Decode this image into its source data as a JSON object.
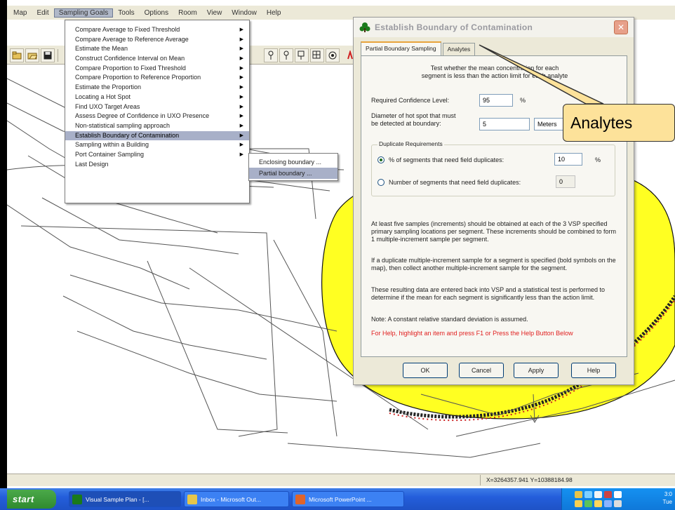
{
  "menubar": {
    "items": [
      "Map",
      "Edit",
      "Sampling Goals",
      "Tools",
      "Options",
      "Room",
      "View",
      "Window",
      "Help"
    ],
    "active_index": 2
  },
  "toolbar": {
    "icons": [
      "open-icon",
      "open-folder-icon",
      "save-icon",
      "print-icon",
      "pin-icon",
      "pin-question-icon",
      "pin-check-icon",
      "pin-grid-icon",
      "target-icon",
      "help-icon"
    ]
  },
  "sampling_menu": {
    "items": [
      {
        "label": "Compare Average to Fixed Threshold",
        "submenu": true
      },
      {
        "label": "Compare Average to Reference Average",
        "submenu": true
      },
      {
        "label": "Estimate the Mean",
        "submenu": true
      },
      {
        "label": "Construct Confidence Interval on Mean",
        "submenu": true
      },
      {
        "label": "Compare Proportion to Fixed Threshold",
        "submenu": true
      },
      {
        "label": "Compare Proportion to Reference Proportion",
        "submenu": true
      },
      {
        "label": "Estimate the Proportion",
        "submenu": true
      },
      {
        "label": "Locating a Hot Spot",
        "submenu": true
      },
      {
        "label": "Find UXO Target Areas",
        "submenu": true
      },
      {
        "label": "Assess Degree of Confidence in UXO Presence",
        "submenu": true
      },
      {
        "label": "Non-statistical sampling approach",
        "submenu": true
      },
      {
        "label": "Establish Boundary of Contamination",
        "submenu": true,
        "highlighted": true
      },
      {
        "label": "Sampling within a Building",
        "submenu": true
      },
      {
        "label": "Port Container Sampling",
        "submenu": true
      },
      {
        "label": "Last Design",
        "submenu": false
      }
    ],
    "submenu": [
      {
        "label": "Enclosing boundary ...",
        "highlighted": false
      },
      {
        "label": "Partial boundary ...",
        "highlighted": true
      }
    ]
  },
  "dialog": {
    "title": "Establish Boundary of Contamination",
    "close_label": "✕",
    "tabs": [
      {
        "label": "Partial Boundary Sampling",
        "active": true
      },
      {
        "label": "Analytes",
        "active": false
      }
    ],
    "intro_line1": "Test whether the mean concentration for each",
    "intro_line2": "segment is less than the action limit for each analyte",
    "confidence_label": "Required Confidence Level:",
    "confidence_value": "95",
    "confidence_unit": "%",
    "diameter_label_line1": "Diameter of hot spot that must",
    "diameter_label_line2": "be detected at boundary:",
    "diameter_value": "5",
    "diameter_unit": "Meters",
    "dup_group_label": "Duplicate Requirements",
    "dup_pct_label": "% of segments that need field duplicates:",
    "dup_pct_value": "10",
    "dup_pct_unit": "%",
    "dup_pct_checked": true,
    "dup_num_label": "Number of segments that need field duplicates:",
    "dup_num_value": "0",
    "para1": "At least five samples (increments) should be obtained at each of the 3 VSP specified primary sampling locations per segment.  These increments should be combined to form 1 multiple-increment sample per segment.",
    "para2": "If a duplicate multiple-increment sample for a segment is specified (bold symbols on the map), then collect another multiple-increment sample for the segment.",
    "para3": "These resulting data are entered back into VSP and a statistical test is performed to determine if the mean for each segment is significantly less than the action limit.",
    "note": "Note:  A constant relative standard deviation is assumed.",
    "help_hint": "For Help, highlight an item and press F1 or Press the Help Button Below",
    "buttons": {
      "ok": "OK",
      "cancel": "Cancel",
      "apply": "Apply",
      "help": "Help"
    }
  },
  "callout": {
    "label": "Analytes",
    "color": "#fde29a"
  },
  "statusbar": {
    "coords": "X=3264357.941 Y=10388184.98"
  },
  "taskbar": {
    "start_label": "start",
    "tasks": [
      {
        "label": "Visual Sample Plan - [...",
        "active": true
      },
      {
        "label": "Inbox - Microsoft Out...",
        "active": false
      },
      {
        "label": "Microsoft PowerPoint ...",
        "active": false
      }
    ],
    "clock_line1": "3:0",
    "clock_line2": "Tue"
  },
  "colors": {
    "yellow_region": "#ffff22",
    "menu_highlight": "#a8b0c8",
    "help_text": "#e02020"
  }
}
